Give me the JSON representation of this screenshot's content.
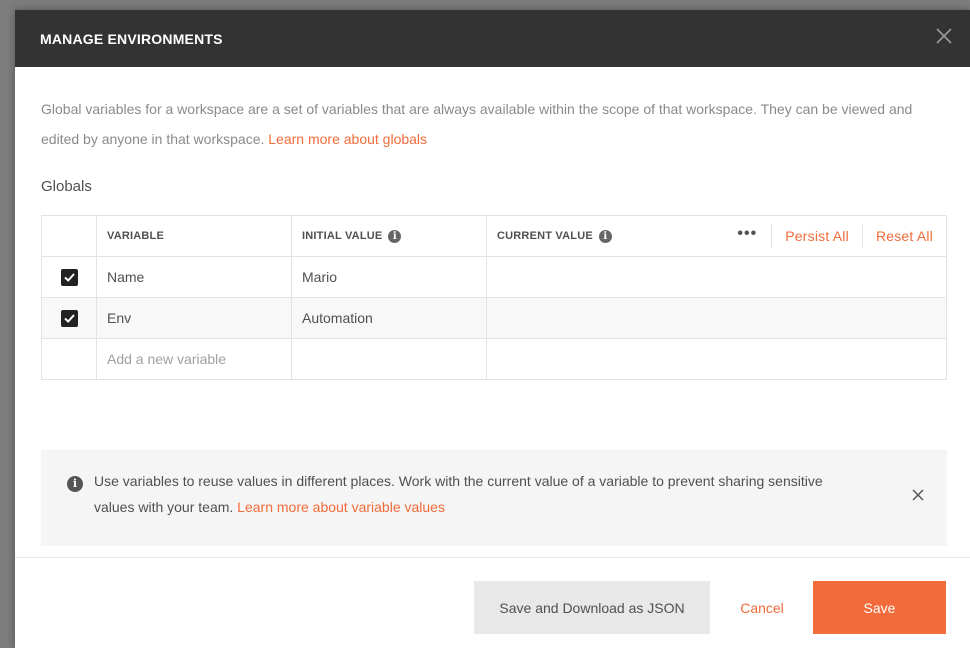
{
  "modal": {
    "title": "MANAGE ENVIRONMENTS",
    "close_icon": "close-icon"
  },
  "description": {
    "text": "Global variables for a workspace are a set of variables that are always available within the scope of that workspace. They can be viewed and edited by anyone in that workspace. ",
    "link": "Learn more about globals"
  },
  "globals": {
    "label": "Globals",
    "headers": {
      "variable": "VARIABLE",
      "initial_value": "INITIAL VALUE",
      "current_value": "CURRENT VALUE",
      "more": "•••",
      "persist_all": "Persist All",
      "reset_all": "Reset All"
    },
    "rows": [
      {
        "checked": true,
        "variable": "Name",
        "initial_value": "Mario",
        "current_value": ""
      },
      {
        "checked": true,
        "variable": "Env",
        "initial_value": "Automation",
        "current_value": ""
      }
    ],
    "new_row_placeholder": "Add a new variable"
  },
  "banner": {
    "text": "Use variables to reuse values in different places. Work with the current value of a variable to prevent sharing sensitive values with your team. ",
    "link": "Learn more about variable values"
  },
  "footer": {
    "save_json_label": "Save and Download as JSON",
    "cancel_label": "Cancel",
    "save_label": "Save"
  },
  "colors": {
    "accent": "#f26b3a",
    "header_bg": "#333333"
  }
}
